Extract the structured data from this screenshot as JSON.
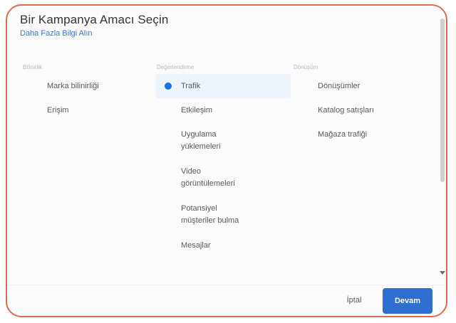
{
  "dialog": {
    "title": "Bir Kampanya Amacı Seçin",
    "learn_more": "Daha Fazla Bilgi Alın"
  },
  "columns": [
    {
      "header": "Bilinirlik",
      "options": [
        {
          "label": "Marka bilinirliği",
          "selected": false
        },
        {
          "label": "Erişim",
          "selected": false
        }
      ]
    },
    {
      "header": "Değerlendirme",
      "options": [
        {
          "label": "Trafik",
          "selected": true
        },
        {
          "label": "Etkileşim",
          "selected": false
        },
        {
          "label": "Uygulama\nyüklemeleri",
          "selected": false
        },
        {
          "label": "Video\ngörüntülemeleri",
          "selected": false
        },
        {
          "label": "Potansiyel\nmüşteriler bulma",
          "selected": false
        },
        {
          "label": "Mesajlar",
          "selected": false
        }
      ]
    },
    {
      "header": "Dönüşüm",
      "options": [
        {
          "label": "Dönüşümler",
          "selected": false
        },
        {
          "label": "Katalog satışları",
          "selected": false
        },
        {
          "label": "Mağaza trafiği",
          "selected": false
        }
      ]
    }
  ],
  "footer": {
    "cancel": "İptal",
    "continue": "Devam"
  },
  "colors": {
    "accent": "#1a73e8",
    "primary_button": "#2f6fd0",
    "frame_border": "#e06a4e"
  },
  "icons": {
    "selected_radio": "radio-selected-icon"
  }
}
